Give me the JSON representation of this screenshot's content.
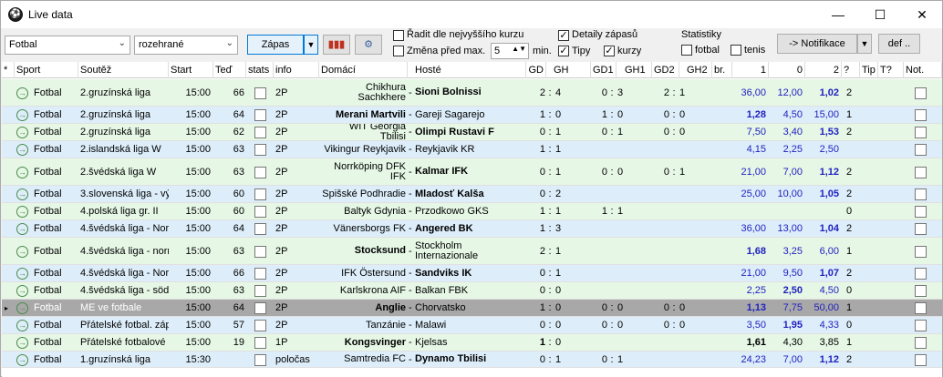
{
  "window": {
    "title": "Live data",
    "icon": "soccer-ball-icon",
    "minimize": "—",
    "maximize": "☐",
    "close": "✕"
  },
  "toolbar": {
    "sport_value": "Fotbal",
    "filter_value": "rozehrané",
    "zapas_label": "Zápas",
    "sort_label": "Řadit dle nejvyššího kurzu",
    "change_label": "Změna před max.",
    "change_value": "5",
    "min_label": "min.",
    "details_label": "Detaily zápasů",
    "tipy_label": "Tipy",
    "kurzy_label": "kurzy",
    "stats_title": "Statistiky",
    "fotbal_label": "fotbal",
    "tenis_label": "tenis",
    "notif_label": "-> Notifikace",
    "def_label": "def .."
  },
  "headers": {
    "star": "*",
    "sport": "Sport",
    "soutez": "Soutěž",
    "start": "Start",
    "ted": "Teď",
    "stats": "stats",
    "info": "info",
    "domaci": "Domácí",
    "hoste": "Hosté",
    "gd": "GD",
    "gh": "GH",
    "gd1": "GD1",
    "gh1": "GH1",
    "gd2": "GD2",
    "gh2": "GH2",
    "br": "br.",
    "k1": "1",
    "k0": "0",
    "k2": "2",
    "q": "?",
    "tip": "Tip",
    "tq": "T?",
    "not": "Not."
  },
  "rows": [
    {
      "sport": "Fotbal",
      "league": "2.gruzínská liga",
      "start": "15:00",
      "now": "66",
      "info": "2P",
      "home": "Chikhura Sachkhere",
      "guest": "Sioni Bolnissi",
      "gd": "2",
      "gh": "4",
      "h1": "0",
      "g1": "3",
      "h2": "2",
      "g2": "1",
      "k1": "36,00",
      "k0": "12,00",
      "k2": "1,02",
      "q": "2",
      "bold": "guest",
      "hb": "k2",
      "color": "#e6f7e6"
    },
    {
      "sport": "Fotbal",
      "league": "2.gruzínská liga",
      "start": "15:00",
      "now": "64",
      "info": "2P",
      "home": "Merani Martvili",
      "guest": "Gareji Sagarejo",
      "gd": "1",
      "gh": "0",
      "h1": "1",
      "g1": "0",
      "h2": "0",
      "g2": "0",
      "k1": "1,28",
      "k0": "4,50",
      "k2": "15,00",
      "q": "1",
      "bold": "home",
      "hb": "k1",
      "color": "#ddeefa"
    },
    {
      "sport": "Fotbal",
      "league": "2.gruzínská liga",
      "start": "15:00",
      "now": "62",
      "info": "2P",
      "home": "WIT Georgia Tbilisi",
      "guest": "Olimpi Rustavi F",
      "gd": "0",
      "gh": "1",
      "h1": "0",
      "g1": "1",
      "h2": "0",
      "g2": "0",
      "k1": "7,50",
      "k0": "3,40",
      "k2": "1,53",
      "q": "2",
      "bold": "guest",
      "hb": "k2",
      "color": "#e6f7e6"
    },
    {
      "sport": "Fotbal",
      "league": "2.islandská liga W",
      "start": "15:00",
      "now": "63",
      "info": "2P",
      "home": "Vikingur Reykjavik",
      "guest": "Reykjavik KR",
      "gd": "1",
      "gh": "1",
      "h1": "",
      "g1": "",
      "h2": "",
      "g2": "",
      "k1": "4,15",
      "k0": "2,25",
      "k2": "2,50",
      "q": "",
      "bold": "",
      "hb": "",
      "color": "#ddeefa"
    },
    {
      "sport": "Fotbal",
      "league": "2.švédská liga W",
      "start": "15:00",
      "now": "63",
      "info": "2P",
      "home": "Norrköping DFK IFK",
      "guest": "Kalmar IFK",
      "gd": "0",
      "gh": "1",
      "h1": "0",
      "g1": "0",
      "h2": "0",
      "g2": "1",
      "k1": "21,00",
      "k0": "7,00",
      "k2": "1,12",
      "q": "2",
      "bold": "guest",
      "hb": "k2",
      "color": "#e6f7e6"
    },
    {
      "sport": "Fotbal",
      "league": "3.slovenská liga - vý",
      "start": "15:00",
      "now": "60",
      "info": "2P",
      "home": "Spišské Podhradie",
      "guest": "Mladosť Kalša",
      "gd": "0",
      "gh": "2",
      "h1": "",
      "g1": "",
      "h2": "",
      "g2": "",
      "k1": "25,00",
      "k0": "10,00",
      "k2": "1,05",
      "q": "2",
      "bold": "guest",
      "hb": "k2",
      "color": "#ddeefa"
    },
    {
      "sport": "Fotbal",
      "league": "4.polská liga gr. II",
      "start": "15:00",
      "now": "60",
      "info": "2P",
      "home": "Baltyk Gdynia",
      "guest": "Przodkowo GKS",
      "gd": "1",
      "gh": "1",
      "h1": "1",
      "g1": "1",
      "h2": "",
      "g2": "",
      "k1": "",
      "k0": "",
      "k2": "",
      "q": "0",
      "bold": "",
      "hb": "",
      "color": "#e6f7e6"
    },
    {
      "sport": "Fotbal",
      "league": "4.švédská liga - Nor",
      "start": "15:00",
      "now": "64",
      "info": "2P",
      "home": "Vänersborgs FK",
      "guest": "Angered BK",
      "gd": "1",
      "gh": "3",
      "h1": "",
      "g1": "",
      "h2": "",
      "g2": "",
      "k1": "36,00",
      "k0": "13,00",
      "k2": "1,04",
      "q": "2",
      "bold": "guest",
      "hb": "k2",
      "color": "#ddeefa"
    },
    {
      "sport": "Fotbal",
      "league": "4.švédská liga - norr",
      "start": "15:00",
      "now": "63",
      "info": "2P",
      "home": "Stocksund",
      "guest": "Stockholm Internazionale",
      "gd": "2",
      "gh": "1",
      "h1": "",
      "g1": "",
      "h2": "",
      "g2": "",
      "k1": "1,68",
      "k0": "3,25",
      "k2": "6,00",
      "q": "1",
      "bold": "home",
      "hb": "k1",
      "color": "#e6f7e6"
    },
    {
      "sport": "Fotbal",
      "league": "4.švédská liga - Nor",
      "start": "15:00",
      "now": "66",
      "info": "2P",
      "home": "IFK Östersund",
      "guest": "Sandviks IK",
      "gd": "0",
      "gh": "1",
      "h1": "",
      "g1": "",
      "h2": "",
      "g2": "",
      "k1": "21,00",
      "k0": "9,50",
      "k2": "1,07",
      "q": "2",
      "bold": "guest",
      "hb": "k2",
      "color": "#ddeefa"
    },
    {
      "sport": "Fotbal",
      "league": "4.švédská liga - söd",
      "start": "15:00",
      "now": "63",
      "info": "2P",
      "home": "Karlskrona AIF",
      "guest": "Balkan FBK",
      "gd": "0",
      "gh": "0",
      "h1": "",
      "g1": "",
      "h2": "",
      "g2": "",
      "k1": "2,25",
      "k0": "2,50",
      "k2": "4,50",
      "q": "0",
      "bold": "",
      "hb": "k0",
      "color": "#e6f7e6"
    },
    {
      "sport": "Fotbal",
      "league": "ME ve fotbale",
      "start": "15:00",
      "now": "64",
      "info": "2P",
      "home": "Anglie",
      "guest": "Chorvatsko",
      "gd": "1",
      "gh": "0",
      "h1": "0",
      "g1": "0",
      "h2": "0",
      "g2": "0",
      "k1": "1,13",
      "k0": "7,75",
      "k2": "50,00",
      "q": "1",
      "bold": "home",
      "hb": "k1",
      "color": "#a8a8a8",
      "selected": true
    },
    {
      "sport": "Fotbal",
      "league": "Přátelské fotbal. záp",
      "start": "15:00",
      "now": "57",
      "info": "2P",
      "home": "Tanzánie",
      "guest": "Malawi",
      "gd": "0",
      "gh": "0",
      "h1": "0",
      "g1": "0",
      "h2": "0",
      "g2": "0",
      "k1": "3,50",
      "k0": "1,95",
      "k2": "4,33",
      "q": "0",
      "bold": "",
      "hb": "k0",
      "color": "#ddeefa"
    },
    {
      "sport": "Fotbal",
      "league": "Přátelské fotbalové",
      "start": "15:00",
      "now": "19",
      "info": "1P",
      "home": "Kongsvinger",
      "guest": "Kjelsas",
      "gd": "1",
      "gh": "0",
      "h1": "",
      "g1": "",
      "h2": "",
      "g2": "",
      "k1": "1,61",
      "k0": "4,30",
      "k2": "3,85",
      "q": "1",
      "bold": "home",
      "hb": "k1",
      "black": true,
      "color": "#e6f7e6"
    },
    {
      "sport": "Fotbal",
      "league": "1.gruzínská liga",
      "start": "15:30",
      "now": "",
      "info": "poločas",
      "home": "Samtredia FC",
      "guest": "Dynamo Tbilisi",
      "gd": "0",
      "gh": "1",
      "h1": "0",
      "g1": "1",
      "h2": "",
      "g2": "",
      "k1": "24,23",
      "k0": "7,00",
      "k2": "1,12",
      "q": "2",
      "bold": "guest",
      "hb": "k2",
      "color": "#ddeefa"
    }
  ],
  "colors": {
    "green_row": "#e6f7e6",
    "blue_row": "#ddeefa",
    "selected_row": "#a8a8a8",
    "odds_blue": "#1f1fbf"
  }
}
